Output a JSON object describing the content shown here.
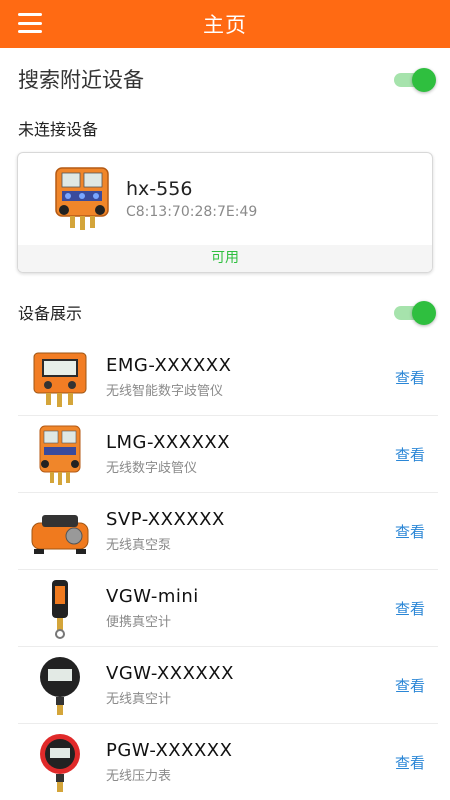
{
  "appbar": {
    "title": "主页",
    "menu_icon": "hamburger-menu-icon"
  },
  "search": {
    "label": "搜索附近设备",
    "toggle_on": true
  },
  "unconnected": {
    "title": "未连接设备",
    "device": {
      "name": "hx-556",
      "mac": "C8:13:70:28:7E:49",
      "status": "可用"
    }
  },
  "showcase": {
    "label": "设备展示",
    "toggle_on": true,
    "items": [
      {
        "name": "EMG-XXXXXX",
        "desc": "无线智能数字歧管仪",
        "action": "查看",
        "icon": "manifold-gauge-icon"
      },
      {
        "name": "LMG-XXXXXX",
        "desc": "无线数字歧管仪",
        "action": "查看",
        "icon": "manifold-gauge-icon"
      },
      {
        "name": "SVP-XXXXXX",
        "desc": "无线真空泵",
        "action": "查看",
        "icon": "vacuum-pump-icon"
      },
      {
        "name": "VGW-mini",
        "desc": "便携真空计",
        "action": "查看",
        "icon": "vacuum-probe-icon"
      },
      {
        "name": "VGW-XXXXXX",
        "desc": "无线真空计",
        "action": "查看",
        "icon": "vacuum-gauge-icon"
      },
      {
        "name": "PGW-XXXXXX",
        "desc": "无线压力表",
        "action": "查看",
        "icon": "pressure-gauge-icon"
      }
    ]
  },
  "colors": {
    "brand": "#ff6a13",
    "toggle": "#2fbf3f",
    "link": "#2a86d6",
    "available": "#2fbf3f"
  }
}
